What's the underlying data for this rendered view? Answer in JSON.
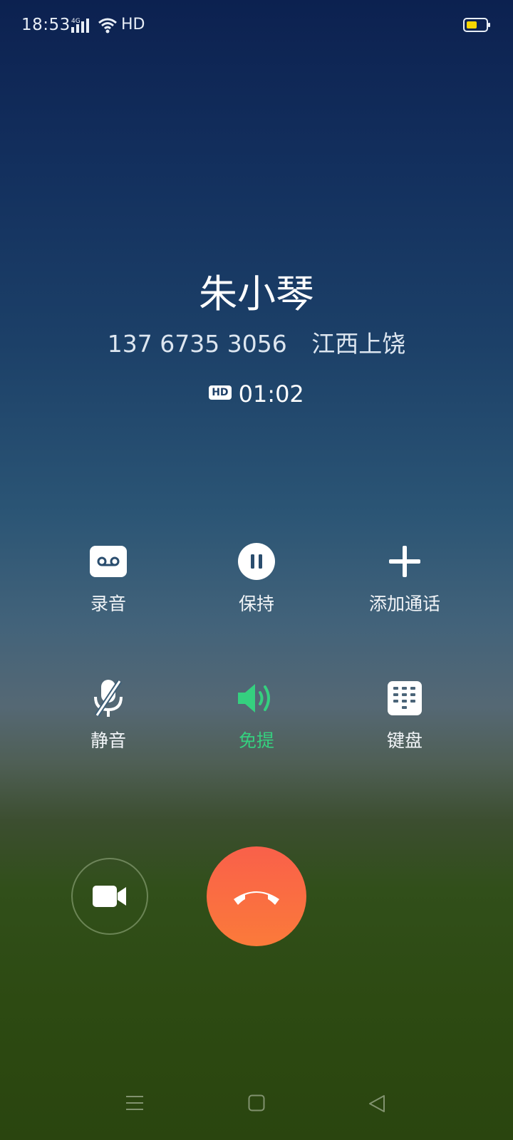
{
  "status_bar": {
    "time": "18:53",
    "network_label": "4G",
    "hd_label": "HD",
    "battery_color": "#f7d600"
  },
  "caller": {
    "name": "朱小琴",
    "number": "137 6735 3056",
    "location": "江西上饶"
  },
  "call": {
    "hd_badge": "HD",
    "duration": "01:02"
  },
  "controls": {
    "record": {
      "label": "录音",
      "icon": "record-tape-icon"
    },
    "hold": {
      "label": "保持",
      "icon": "pause-icon"
    },
    "add_call": {
      "label": "添加通话",
      "icon": "plus-icon"
    },
    "mute": {
      "label": "静音",
      "icon": "mic-off-icon"
    },
    "speaker": {
      "label": "免提",
      "icon": "speaker-icon",
      "active": true,
      "active_color": "#35d07f"
    },
    "keypad": {
      "label": "键盘",
      "icon": "dialpad-icon"
    }
  },
  "buttons": {
    "video": {
      "icon": "video-camera-icon"
    },
    "end_call": {
      "icon": "phone-hangup-icon",
      "color": "#fa6a42"
    }
  },
  "nav": {
    "menu_icon": "menu-icon",
    "home_icon": "home-icon",
    "back_icon": "back-icon"
  }
}
